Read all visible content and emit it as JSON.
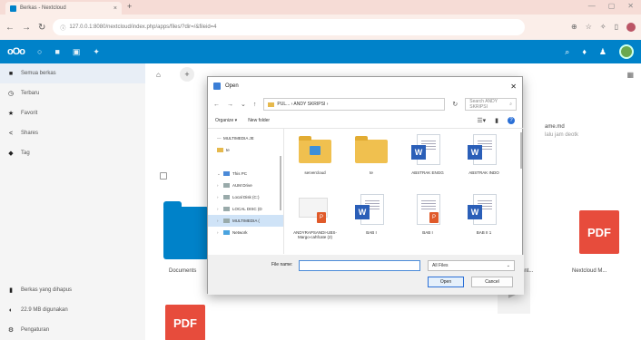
{
  "browser": {
    "tab_title": "Berkas - Nextcloud",
    "tab_close": "×",
    "new_tab": "+",
    "url": "127.0.0.1:8080/nextcloud/index.php/apps/files/?dir=/&fileid=4",
    "window_controls": [
      "—",
      "▢",
      "✕"
    ]
  },
  "header": {
    "logo": "oOo",
    "apps": [
      "○",
      "■",
      "▣",
      "✦"
    ]
  },
  "sidebar": {
    "items": [
      {
        "icon": "■",
        "label": "Semua berkas"
      },
      {
        "icon": "◷",
        "label": "Terbaru"
      },
      {
        "icon": "★",
        "label": "Favorit"
      },
      {
        "icon": "<",
        "label": "Shares"
      },
      {
        "icon": "◆",
        "label": "Tag"
      }
    ],
    "bottom": [
      {
        "icon": "▮",
        "label": "Berkas yang dihapus"
      },
      {
        "icon": "◐",
        "label": "22.9 MB digunakan"
      },
      {
        "icon": "⚙",
        "label": "Pengaturan"
      }
    ]
  },
  "files": {
    "home": "⌂",
    "add": "+",
    "recommend_title": "ame.md",
    "recommend_sub": "lalu jam deotk",
    "items": [
      {
        "label": "Documents"
      },
      {
        "label": "Nextcloud M..."
      },
      {
        "label": "int..."
      }
    ],
    "pdf_label": "PDF"
  },
  "dialog": {
    "title": "Open",
    "close": "✕",
    "path": "PUL... › ANDY SKRIPSI ›",
    "search_placeholder": "Search ANDY SKRIPSI",
    "organize": "Organize ▾",
    "new_folder": "New folder",
    "tree": [
      {
        "label": "MULTIMEDIA JE",
        "type": "folder"
      },
      {
        "label": "te",
        "type": "folder"
      },
      {
        "label": "This PC",
        "type": "pc"
      },
      {
        "label": "AUM Drive",
        "type": "drive"
      },
      {
        "label": "Local Disk (C:)",
        "type": "drive"
      },
      {
        "label": "LOCAL DISC (D",
        "type": "drive"
      },
      {
        "label": "MULTIMEDIA (",
        "type": "drive"
      },
      {
        "label": "Network",
        "type": "net"
      }
    ],
    "tiles": [
      {
        "label": "servercloud",
        "kind": "folder-special"
      },
      {
        "label": "te",
        "kind": "folder"
      },
      {
        "label": "ABSTRAK ENGG",
        "kind": "word"
      },
      {
        "label": "ABSTRAK INDO",
        "kind": "word"
      },
      {
        "label": "ANDYRAPSANDI-UBS-Margo-cahfcate (2)",
        "kind": "pdf-thumb"
      },
      {
        "label": "BAB I",
        "kind": "word"
      },
      {
        "label": "BAB I",
        "kind": "pdf"
      },
      {
        "label": "BAB II 1",
        "kind": "word"
      }
    ],
    "filename_label": "File name:",
    "filetype": "All Files",
    "open_button": "Open",
    "cancel_button": "Cancel"
  }
}
